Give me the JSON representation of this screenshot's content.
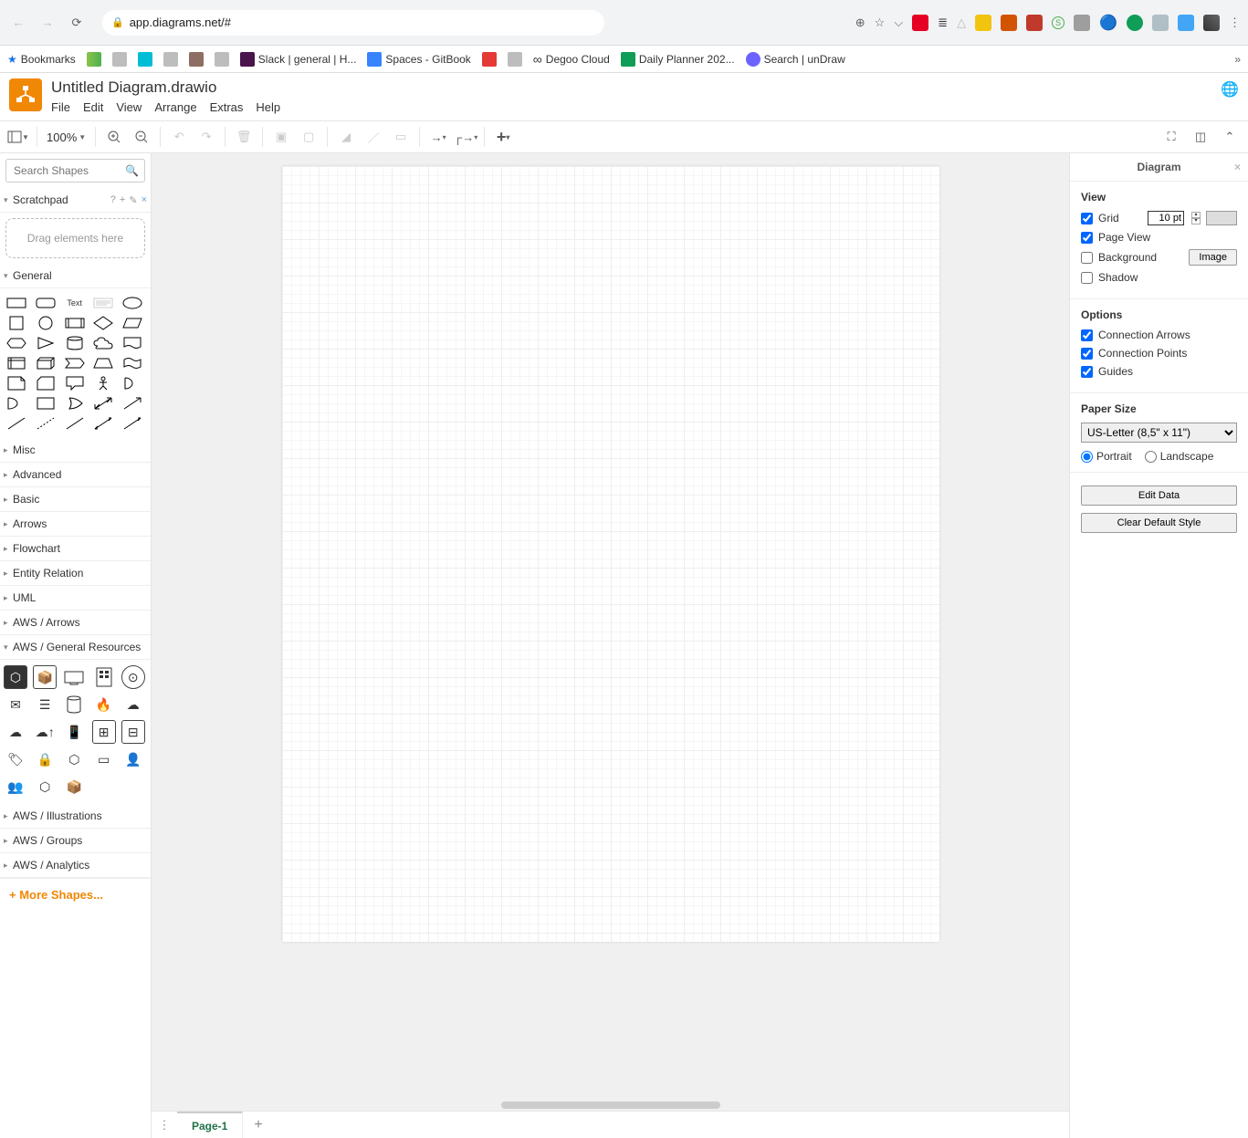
{
  "browser": {
    "url": "app.diagrams.net/#",
    "bookmarks_label": "Bookmarks",
    "bookmarks": [
      {
        "label": "Slack | general | H...",
        "color": "#4a154b"
      },
      {
        "label": "Spaces - GitBook",
        "color": "#3884ff"
      },
      {
        "label": "Degoo Cloud",
        "color": "#000"
      },
      {
        "label": "Daily Planner 202...",
        "color": "#0f9d58"
      },
      {
        "label": "Search | unDraw",
        "color": "#6c63ff"
      }
    ]
  },
  "app": {
    "title": "Untitled Diagram.drawio",
    "menus": [
      "File",
      "Edit",
      "View",
      "Arrange",
      "Extras",
      "Help"
    ],
    "zoom": "100%"
  },
  "sidebar": {
    "search_placeholder": "Search Shapes",
    "scratchpad_label": "Scratchpad",
    "scratchpad_hint": "Drag elements here",
    "sections": [
      "General",
      "Misc",
      "Advanced",
      "Basic",
      "Arrows",
      "Flowchart",
      "Entity Relation",
      "UML",
      "AWS / Arrows",
      "AWS / General Resources",
      "AWS / Illustrations",
      "AWS / Groups",
      "AWS / Analytics"
    ],
    "more_shapes": "More Shapes...",
    "text_shape_label": "Text"
  },
  "tabs": {
    "page1": "Page-1"
  },
  "rpanel": {
    "title": "Diagram",
    "view_heading": "View",
    "grid_label": "Grid",
    "grid_size": "10 pt",
    "pageview_label": "Page View",
    "background_label": "Background",
    "image_btn": "Image",
    "shadow_label": "Shadow",
    "options_heading": "Options",
    "conn_arrows_label": "Connection Arrows",
    "conn_points_label": "Connection Points",
    "guides_label": "Guides",
    "paper_heading": "Paper Size",
    "paper_value": "US-Letter (8,5\" x 11\")",
    "portrait_label": "Portrait",
    "landscape_label": "Landscape",
    "edit_data_btn": "Edit Data",
    "clear_style_btn": "Clear Default Style"
  }
}
